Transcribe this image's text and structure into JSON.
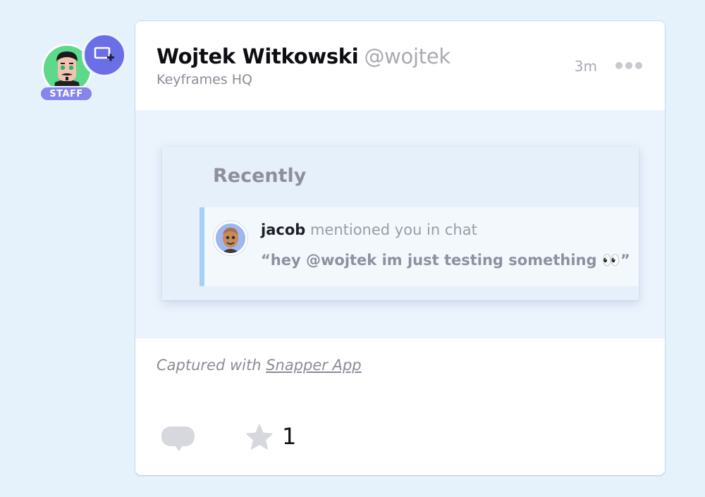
{
  "author": {
    "name": "Wojtek Witkowski",
    "handle": "@wojtek",
    "organization": "Keyframes HQ",
    "badge": "STAFF",
    "avatar_icon": "man-with-mustache-avatar",
    "accent_color": "#6b6fe6"
  },
  "post": {
    "timestamp": "3m",
    "more_icon": "ellipsis-icon"
  },
  "screenshot": {
    "section_title": "Recently",
    "notification": {
      "user": "jacob",
      "action_text": " mentioned you in chat",
      "quote": "“hey @wojtek im just testing something 👀”"
    }
  },
  "caption": {
    "prefix": "Captured with ",
    "link_text": "Snapper App"
  },
  "actions": {
    "comment_icon": "comment-bubble-icon",
    "star_icon": "star-icon",
    "star_count": "1"
  }
}
